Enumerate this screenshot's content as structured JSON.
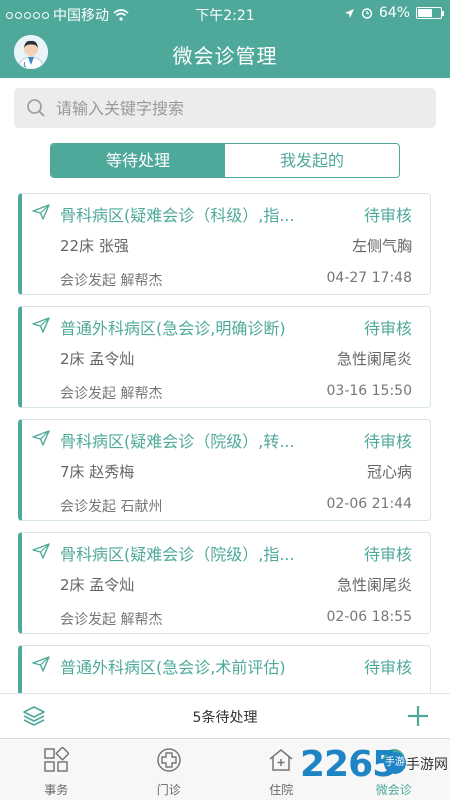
{
  "status_bar": {
    "carrier": "中国移动",
    "time": "下午2:21",
    "battery": "64%",
    "battery_level": 0.64
  },
  "header": {
    "title": "微会诊管理"
  },
  "search": {
    "placeholder": "请输入关键字搜索"
  },
  "tabs": [
    {
      "label": "等待处理",
      "active": true
    },
    {
      "label": "我发起的",
      "active": false
    }
  ],
  "consultations": [
    {
      "title": "骨科病区(疑难会诊（科级）,指...",
      "status": "待审核",
      "patient": "22床 张强",
      "diagnosis": "左侧气胸",
      "initiator": "会诊发起 解帮杰",
      "time": "04-27 17:48"
    },
    {
      "title": "普通外科病区(急会诊,明确诊断)",
      "status": "待审核",
      "patient": "2床 孟令灿",
      "diagnosis": "急性阑尾炎",
      "initiator": "会诊发起 解帮杰",
      "time": "03-16 15:50"
    },
    {
      "title": "骨科病区(疑难会诊（院级）,转...",
      "status": "待审核",
      "patient": "7床 赵秀梅",
      "diagnosis": "冠心病",
      "initiator": "会诊发起 石献州",
      "time": "02-06 21:44"
    },
    {
      "title": "骨科病区(疑难会诊（院级）,指...",
      "status": "待审核",
      "patient": "2床 孟令灿",
      "diagnosis": "急性阑尾炎",
      "initiator": "会诊发起 解帮杰",
      "time": "02-06 18:55"
    },
    {
      "title": "普通外科病区(急会诊,术前评估)",
      "status": "待审核",
      "patient": "",
      "diagnosis": "",
      "initiator": "",
      "time": ""
    }
  ],
  "action_bar": {
    "pending_count": "5条待处理"
  },
  "bottom_nav": [
    {
      "label": "事务",
      "icon": "grid-icon"
    },
    {
      "label": "门诊",
      "icon": "medical-cross-icon"
    },
    {
      "label": "住院",
      "icon": "hospital-house-icon"
    },
    {
      "label": "微会诊",
      "icon": "consultation-icon"
    }
  ],
  "watermark": {
    "number": "2265",
    "badge": "手游",
    "text": "手游网"
  },
  "colors": {
    "primary": "#4fa99b",
    "watermark": "#1f84c4"
  }
}
